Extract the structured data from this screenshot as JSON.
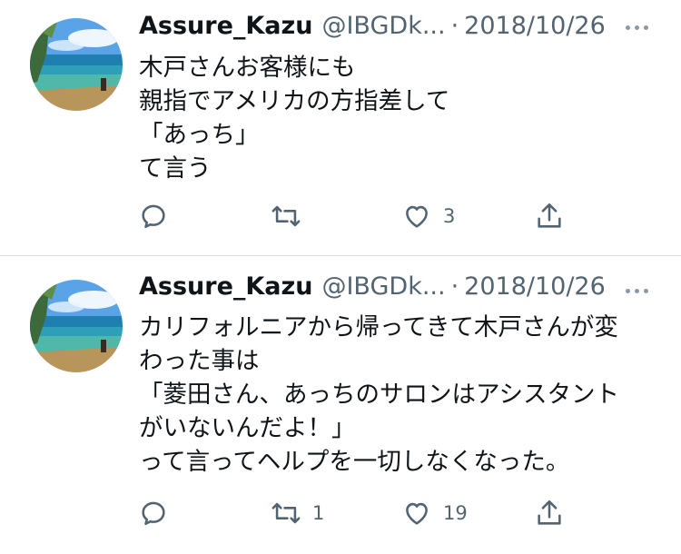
{
  "tweets": [
    {
      "name": "Assure_Kazu",
      "handle": "@IBGDk...",
      "separator": "·",
      "date": "2018/10/26",
      "lines": [
        "木戸さんお客様にも",
        "親指でアメリカの方指差して",
        "「あっち」",
        "て言う"
      ],
      "replies": "",
      "retweets": "",
      "likes": "3"
    },
    {
      "name": "Assure_Kazu",
      "handle": "@IBGDk...",
      "separator": "·",
      "date": "2018/10/26",
      "lines": [
        "カリフォルニアから帰ってきて木戸さんが変",
        "わった事は",
        "「菱田さん、あっちのサロンはアシスタント",
        "がいないんだよ！」",
        "って言ってヘルプを一切しなくなった。"
      ],
      "replies": "",
      "retweets": "1",
      "likes": "19"
    }
  ],
  "icons": {
    "reply": "speech-bubble-icon",
    "retweet": "retweet-arrows-icon",
    "like": "heart-icon",
    "share": "share-upload-icon",
    "more": "ellipsis-icon"
  },
  "colors": {
    "text": "#0f1419",
    "secondary": "#536471",
    "icon": "#536471",
    "divider": "#dcdfe2"
  }
}
